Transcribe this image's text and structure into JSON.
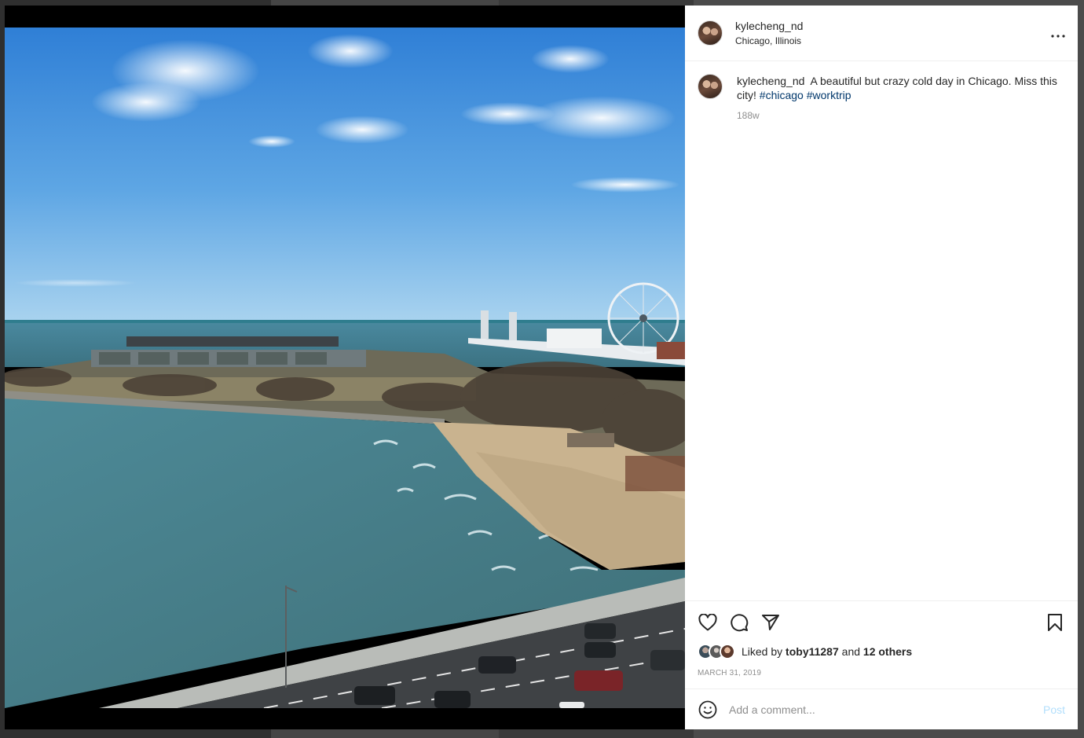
{
  "post": {
    "username": "kylecheng_nd",
    "location": "Chicago, Illinois",
    "more_icon": "more-horizontal-icon"
  },
  "caption": {
    "username": "kylecheng_nd",
    "text": "A beautiful but crazy cold day in Chicago. Miss this city!",
    "hashtags": [
      "#chicago",
      "#worktrip"
    ],
    "age": "188w"
  },
  "actions": {
    "like_icon": "heart-icon",
    "comment_icon": "comment-icon",
    "share_icon": "paper-plane-icon",
    "save_icon": "bookmark-icon"
  },
  "likes": {
    "prefix": "Liked by",
    "user": "toby11287",
    "conjunction": "and",
    "others": "12 others"
  },
  "date": "MARCH 31, 2019",
  "comment_box": {
    "placeholder": "Add a comment...",
    "post_label": "Post",
    "emoji_icon": "smiley-icon"
  },
  "colors": {
    "hashtag": "#00376b",
    "post_button_disabled": "#b2dffc",
    "muted_text": "#8e8e8e"
  }
}
